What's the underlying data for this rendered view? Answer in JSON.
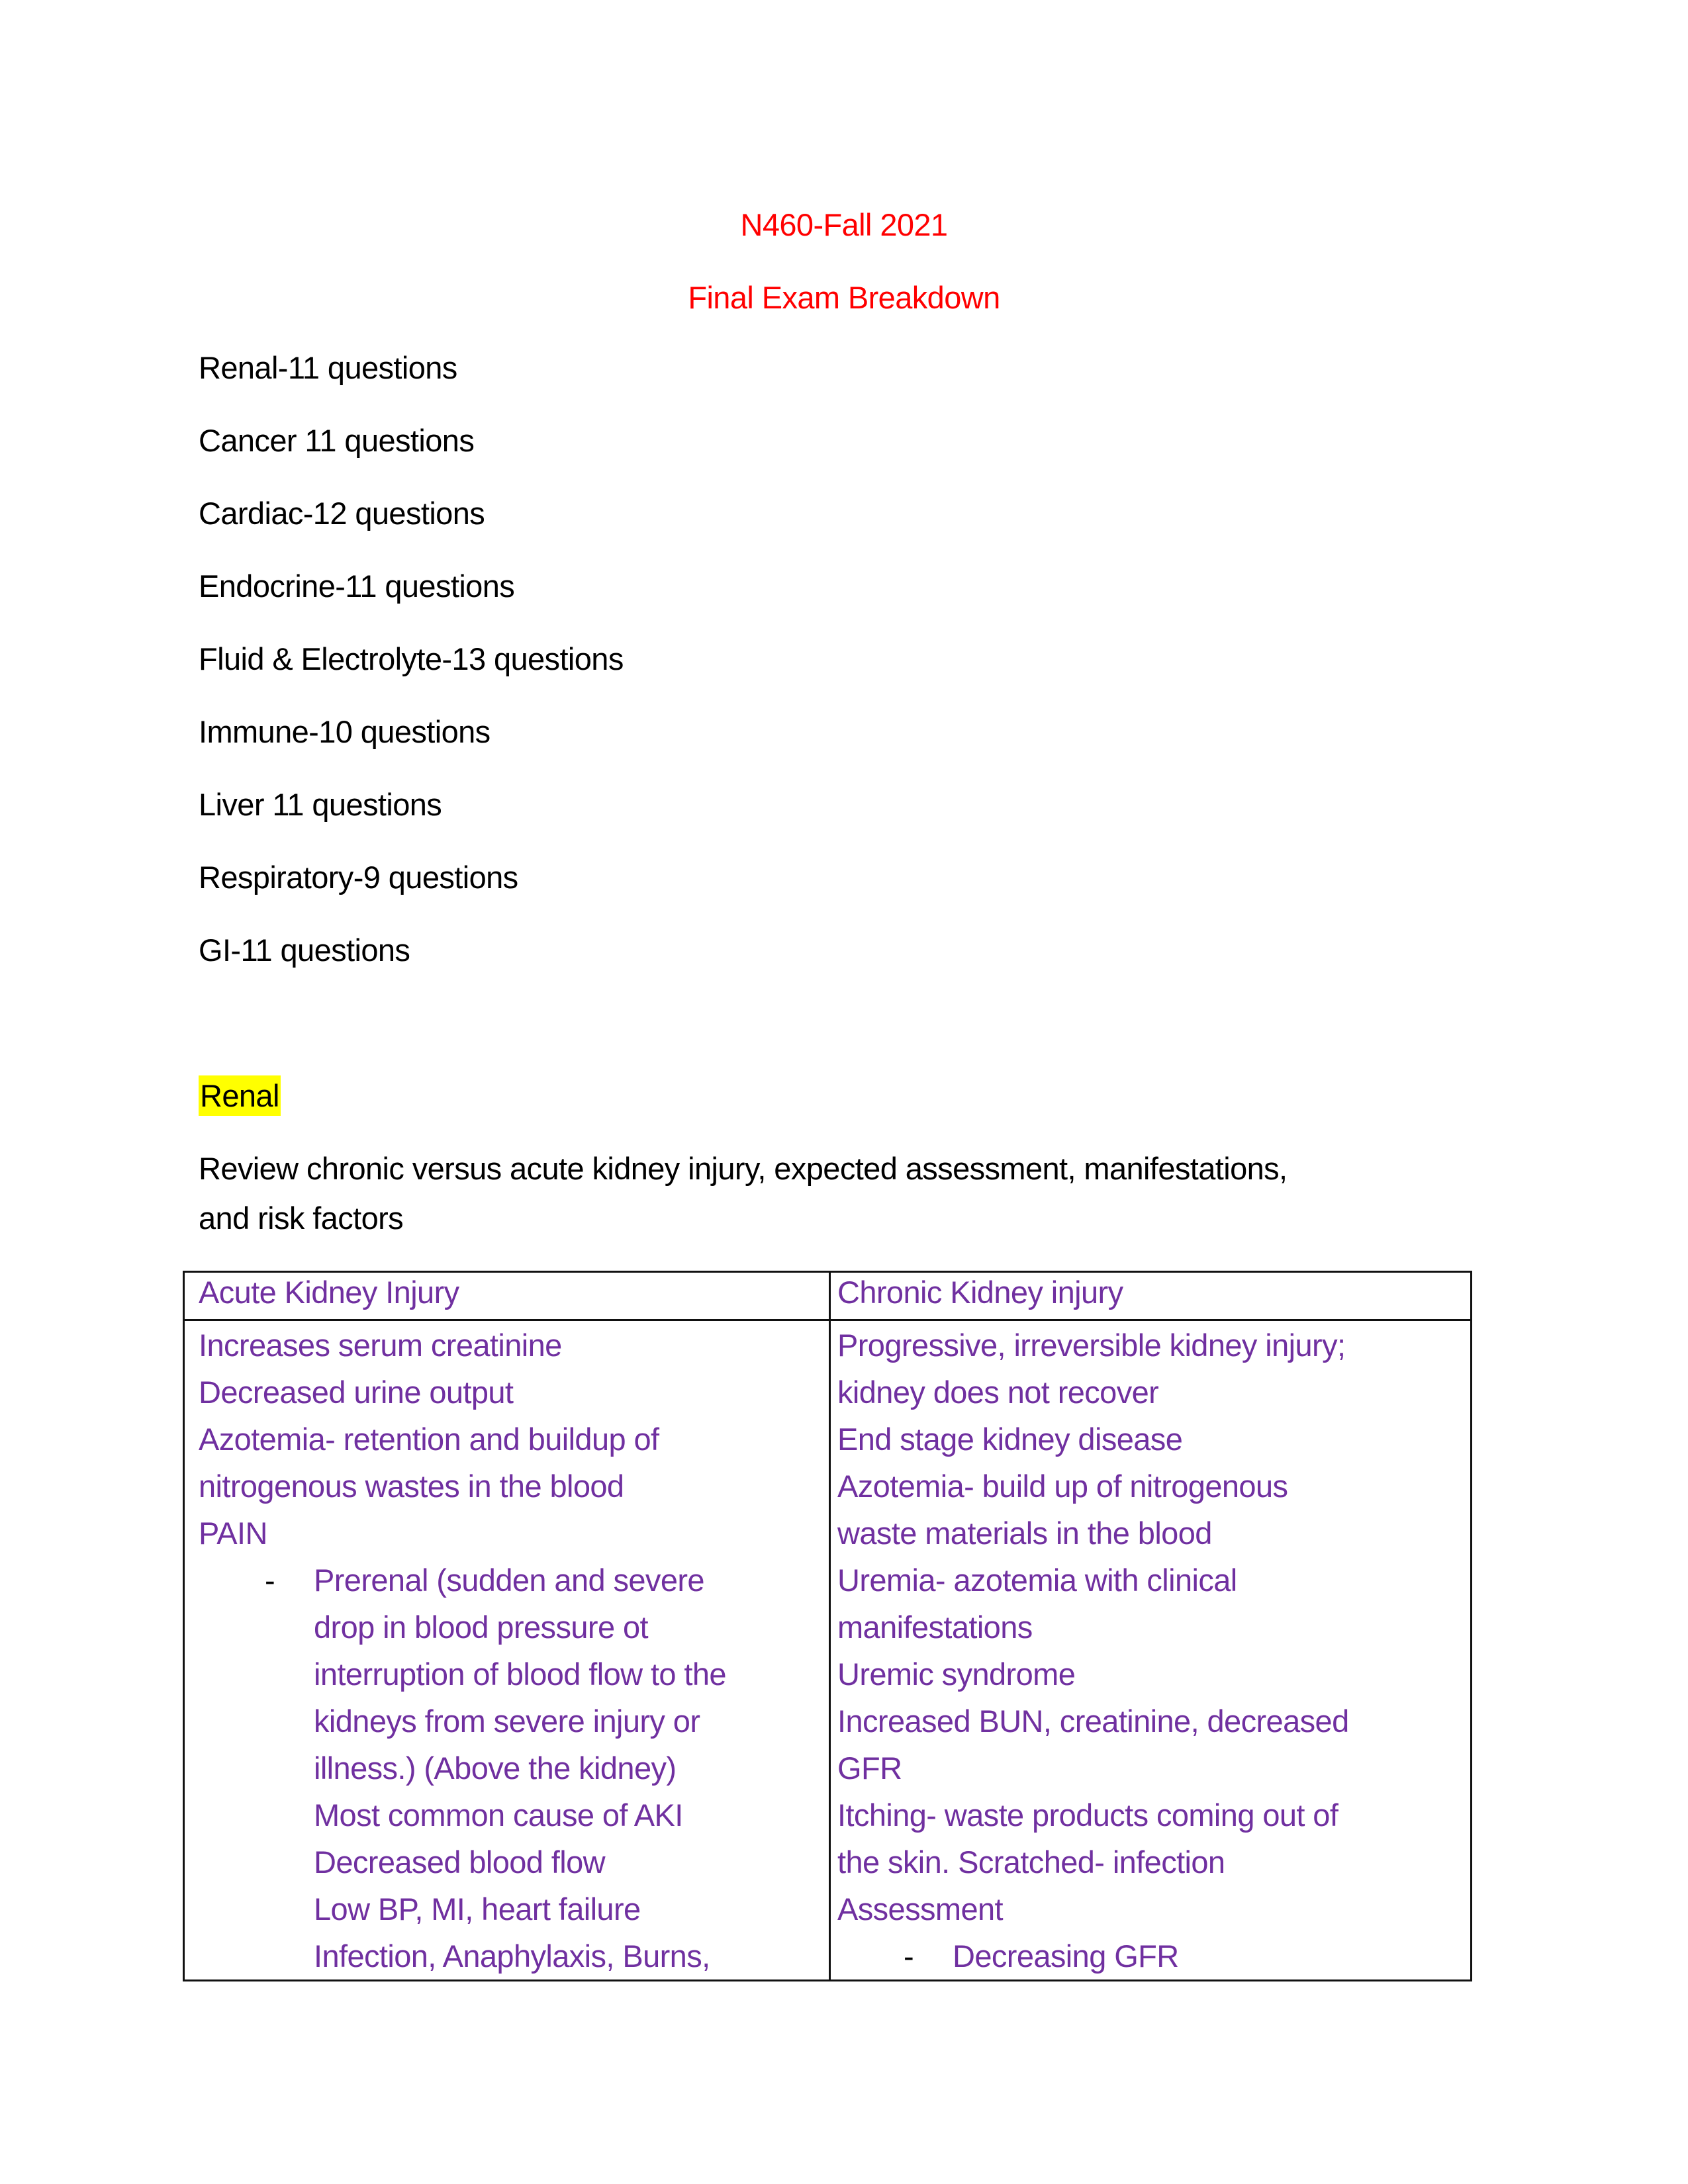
{
  "header": {
    "course": "N460-Fall 2021",
    "title": "Final Exam Breakdown"
  },
  "breakdown": [
    "Renal-11 questions",
    "Cancer 11 questions",
    "Cardiac-12 questions",
    "Endocrine-11 questions",
    "Fluid & Electrolyte-13 questions",
    "Immune-10 questions",
    "Liver 11 questions",
    "Respiratory-9 questions",
    "GI-11 questions"
  ],
  "section": {
    "heading": "Renal",
    "heading_highlight": "#FFFF00",
    "description_lines": [
      "Review chronic versus acute kidney injury, expected assessment, manifestations,",
      "and risk factors"
    ]
  },
  "table": {
    "text_color": "#7030A0",
    "headers": [
      "Acute Kidney Injury",
      "Chronic Kidney injury"
    ],
    "left_lines": [
      {
        "text": "Increases serum creatinine",
        "bullet": false,
        "indent": false
      },
      {
        "text": "Decreased urine output",
        "bullet": false,
        "indent": false
      },
      {
        "text": "Azotemia- retention and buildup of",
        "bullet": false,
        "indent": false
      },
      {
        "text": "nitrogenous wastes in the blood",
        "bullet": false,
        "indent": false
      },
      {
        "text": "PAIN",
        "bullet": false,
        "indent": false
      },
      {
        "text": "Prerenal (sudden and severe",
        "bullet": true,
        "indent": true
      },
      {
        "text": "drop in blood pressure ot",
        "bullet": false,
        "indent": true
      },
      {
        "text": "interruption of blood flow to the",
        "bullet": false,
        "indent": true
      },
      {
        "text": "kidneys from severe injury or",
        "bullet": false,
        "indent": true
      },
      {
        "text": "illness.) (Above the kidney)",
        "bullet": false,
        "indent": true
      },
      {
        "text": "Most common cause of AKI",
        "bullet": false,
        "indent": true
      },
      {
        "text": "Decreased blood flow",
        "bullet": false,
        "indent": true
      },
      {
        "text": "Low BP, MI, heart failure",
        "bullet": false,
        "indent": true
      },
      {
        "text": "Infection, Anaphylaxis, Burns,",
        "bullet": false,
        "indent": true
      }
    ],
    "right_lines": [
      {
        "text": "Progressive, irreversible kidney injury;",
        "bullet": false,
        "indent": false
      },
      {
        "text": "kidney does not recover",
        "bullet": false,
        "indent": false
      },
      {
        "text": "End stage kidney disease",
        "bullet": false,
        "indent": false
      },
      {
        "text": "Azotemia- build up of nitrogenous",
        "bullet": false,
        "indent": false
      },
      {
        "text": "waste materials in the blood",
        "bullet": false,
        "indent": false
      },
      {
        "text": "Uremia- azotemia with clinical",
        "bullet": false,
        "indent": false
      },
      {
        "text": "manifestations",
        "bullet": false,
        "indent": false
      },
      {
        "text": "Uremic syndrome",
        "bullet": false,
        "indent": false
      },
      {
        "text": "Increased BUN, creatinine, decreased",
        "bullet": false,
        "indent": false
      },
      {
        "text": "GFR",
        "bullet": false,
        "indent": false
      },
      {
        "text": "Itching- waste products coming out of",
        "bullet": false,
        "indent": false
      },
      {
        "text": "the skin. Scratched- infection",
        "bullet": false,
        "indent": false
      },
      {
        "text": "Assessment",
        "bullet": false,
        "indent": false
      },
      {
        "text": "Decreasing GFR",
        "bullet": true,
        "indent": true
      }
    ],
    "bullet_glyph": "-"
  }
}
